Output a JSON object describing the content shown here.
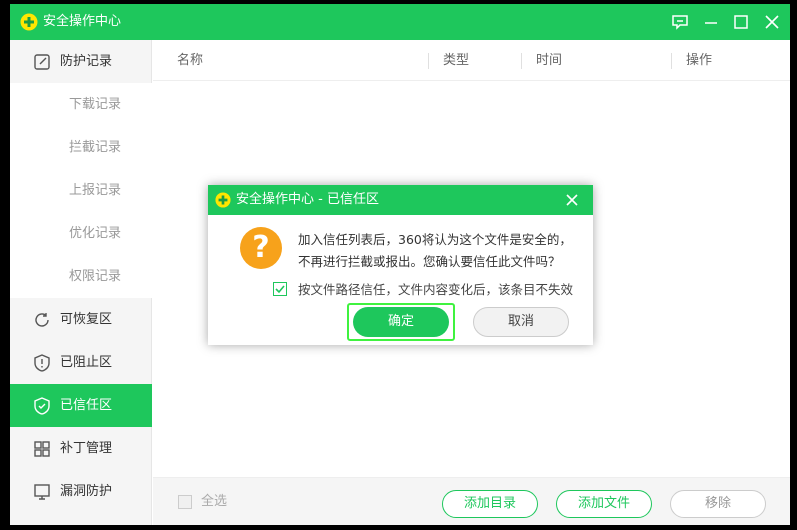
{
  "window": {
    "title": "安全操作中心"
  },
  "sidebar": {
    "items": [
      {
        "label": "防护记录",
        "icon": "edit-icon"
      },
      {
        "label": "下载记录",
        "icon": "download-icon"
      },
      {
        "label": "拦截记录",
        "icon": "block-icon"
      },
      {
        "label": "上报记录",
        "icon": "upload-icon"
      },
      {
        "label": "优化记录",
        "icon": "list-icon"
      },
      {
        "label": "权限记录",
        "icon": "sliders-icon"
      },
      {
        "label": "可恢复区",
        "icon": "restore-icon"
      },
      {
        "label": "已阻止区",
        "icon": "shield-alert-icon"
      },
      {
        "label": "已信任区",
        "icon": "shield-check-icon"
      },
      {
        "label": "补丁管理",
        "icon": "grid-icon"
      },
      {
        "label": "漏洞防护",
        "icon": "monitor-icon"
      }
    ],
    "active_index": 8
  },
  "table": {
    "columns": [
      "名称",
      "类型",
      "时间",
      "操作"
    ]
  },
  "bottom": {
    "select_all": "全选",
    "add_dir": "添加目录",
    "add_file": "添加文件",
    "remove": "移除"
  },
  "dialog": {
    "title": "安全操作中心 - 已信任区",
    "message": "加入信任列表后，360将认为这个文件是安全的，不再进行拦截或报出。您确认要信任此文件吗？",
    "checkbox_label": "按文件路径信任，文件内容变化后，该条目不失效",
    "checkbox_checked": true,
    "ok": "确定",
    "cancel": "取消",
    "icon": "question-mark-icon"
  },
  "colors": {
    "brand_green": "#1ec75c",
    "warning_orange": "#f7a21b",
    "focus_outline": "#3ff23f"
  }
}
